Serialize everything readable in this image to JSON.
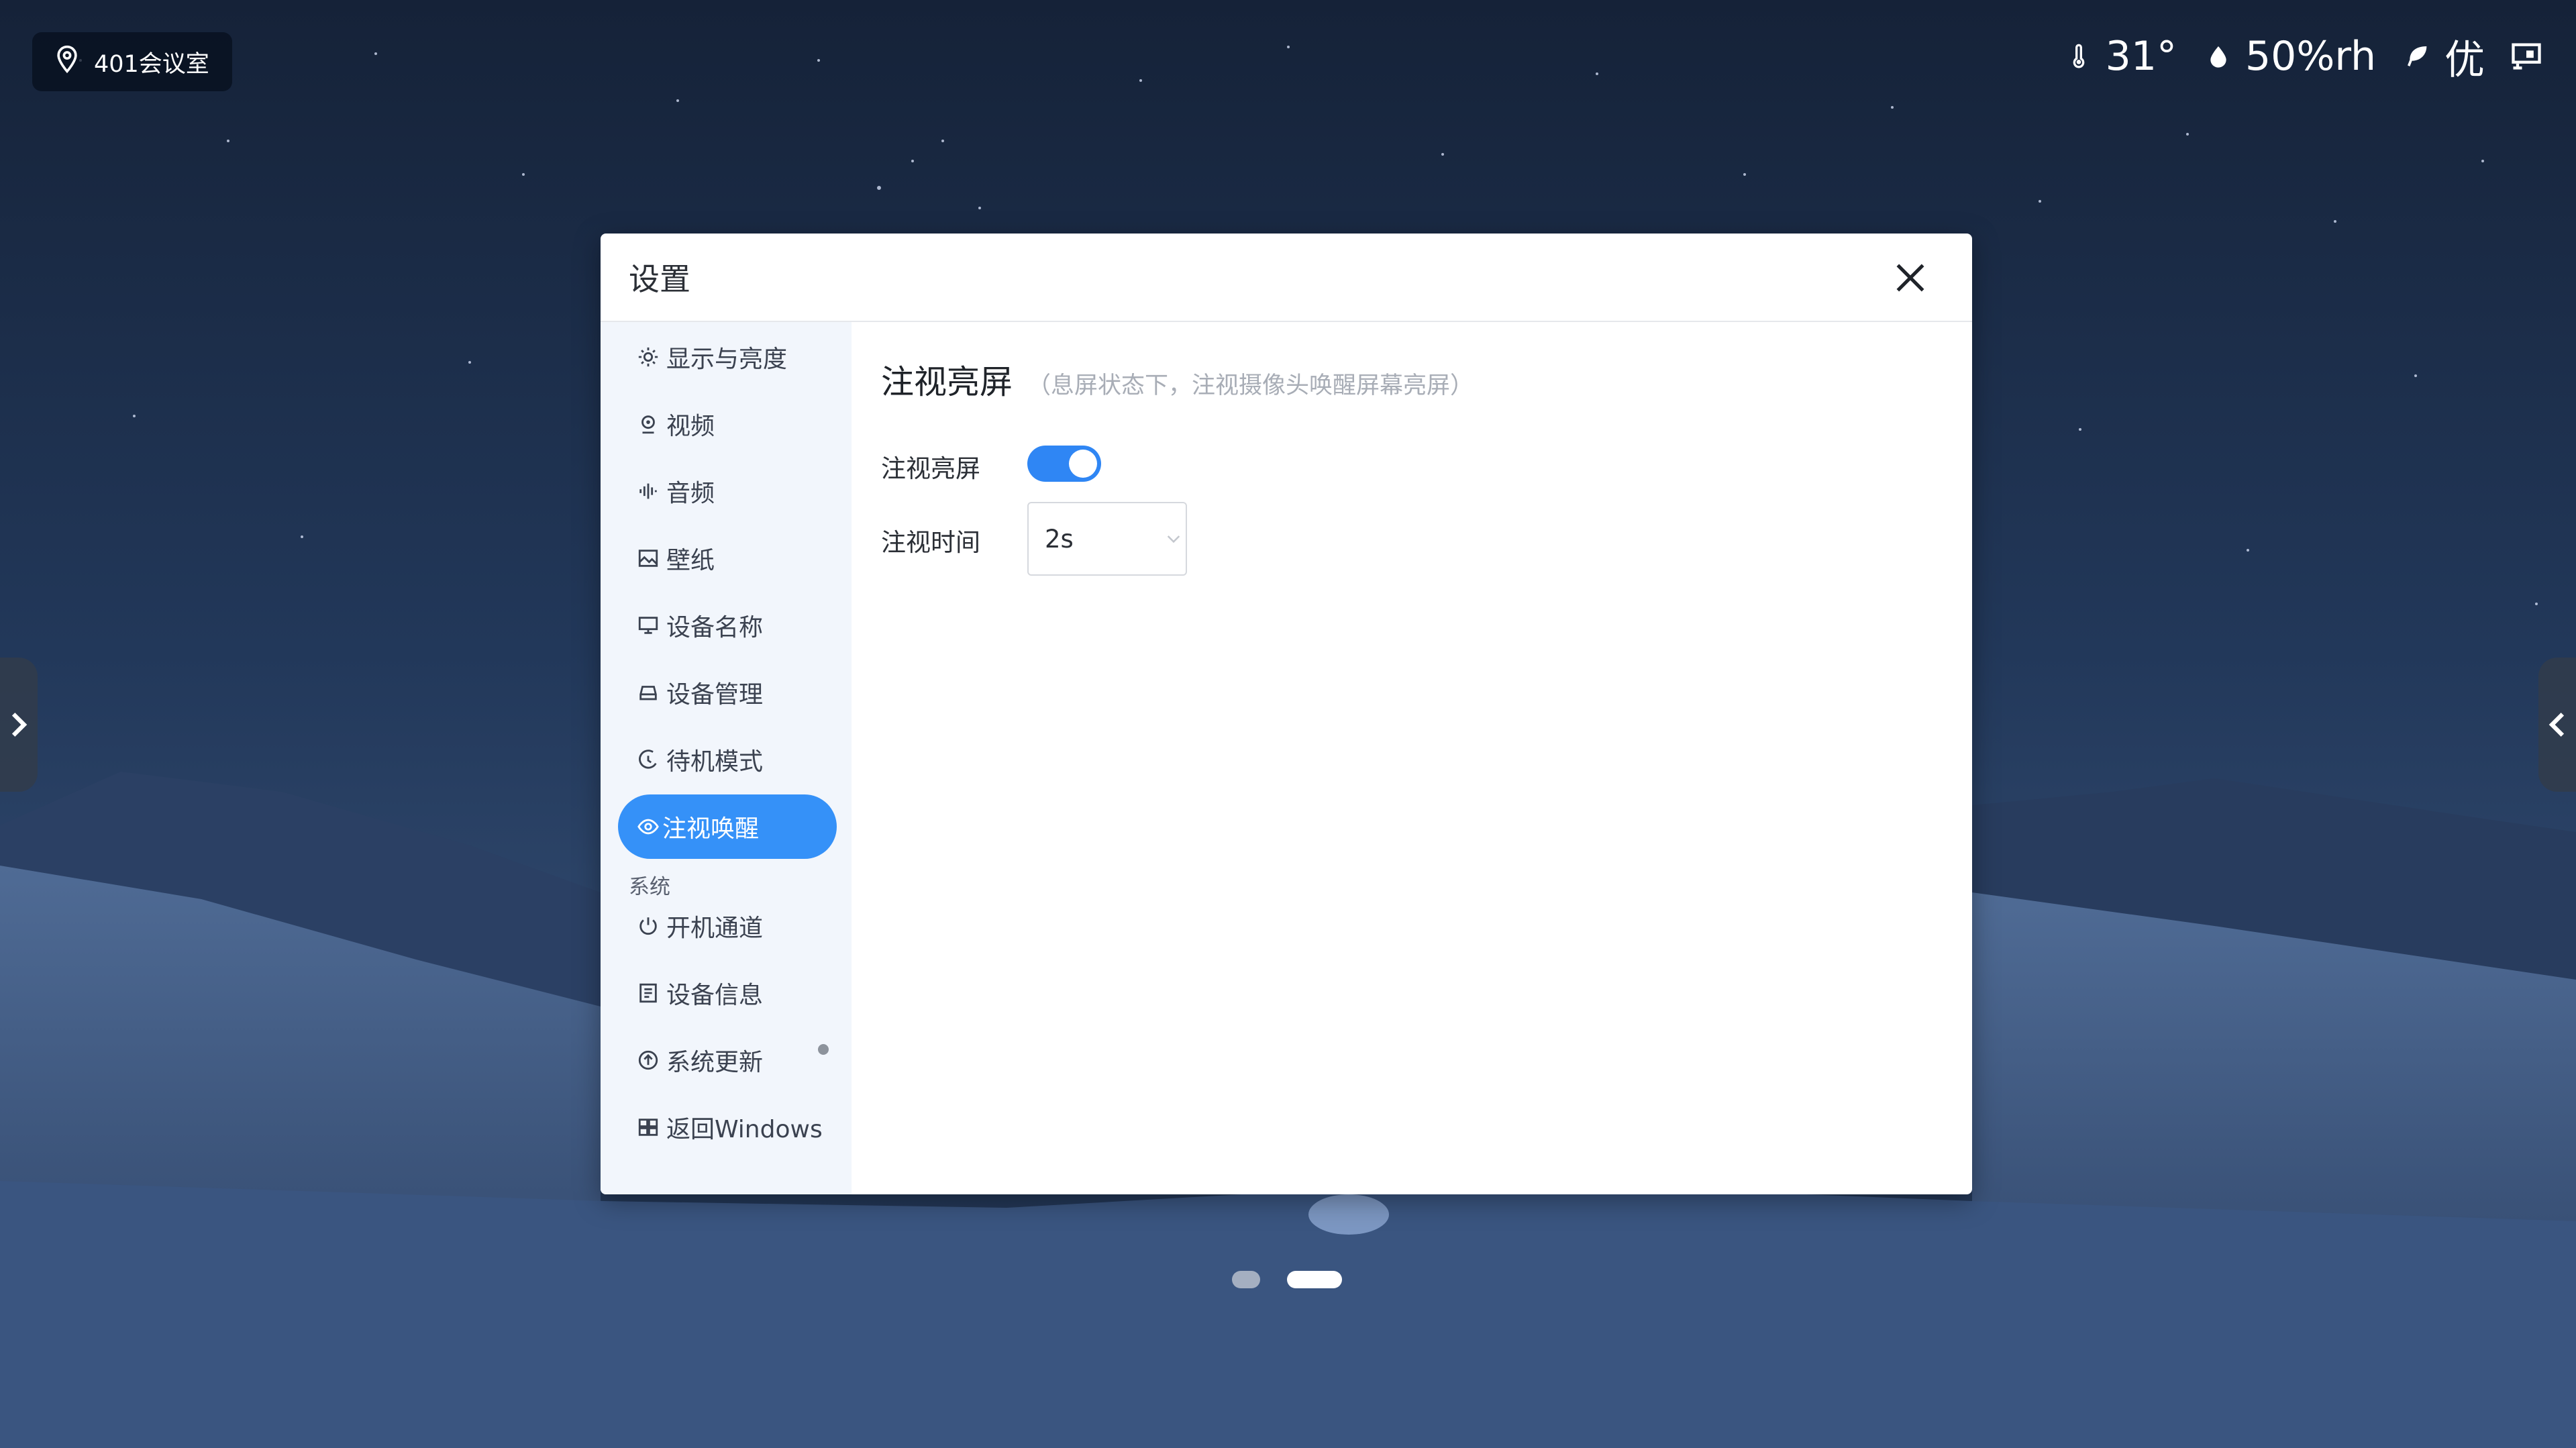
{
  "location": {
    "label": "401会议室",
    "icon": "location-pin-icon"
  },
  "status": {
    "temperature": "31°",
    "humidity": "50%rh",
    "air_quality": "优",
    "icons": [
      "thermometer-icon",
      "water-drop-icon",
      "leaf-icon",
      "screen-cast-icon"
    ]
  },
  "dialog": {
    "title": "设置",
    "sidebar": {
      "items": [
        {
          "label": "显示与亮度",
          "icon": "sun-icon"
        },
        {
          "label": "视频",
          "icon": "camera-icon"
        },
        {
          "label": "音频",
          "icon": "audio-wave-icon"
        },
        {
          "label": "壁纸",
          "icon": "image-icon"
        },
        {
          "label": "设备名称",
          "icon": "monitor-icon"
        },
        {
          "label": "设备管理",
          "icon": "device-manage-icon"
        },
        {
          "label": "待机模式",
          "icon": "standby-icon"
        },
        {
          "label": "注视唤醒",
          "icon": "eye-icon",
          "active": true
        }
      ],
      "group_label": "系统",
      "system_items": [
        {
          "label": "开机通道",
          "icon": "power-icon"
        },
        {
          "label": "设备信息",
          "icon": "info-doc-icon"
        },
        {
          "label": "系统更新",
          "icon": "update-arrow-icon",
          "has_badge": true
        },
        {
          "label": "返回Windows",
          "icon": "windows-icon"
        }
      ]
    },
    "content": {
      "title": "注视亮屏",
      "subtitle": "（息屏状态下，注视摄像头唤醒屏幕亮屏）",
      "toggle_label": "注视亮屏",
      "toggle_on": true,
      "duration_label": "注视时间",
      "duration_value": "2s"
    }
  },
  "pager": {
    "total": 2,
    "active": 2
  },
  "colors": {
    "accent": "#3591f8",
    "sidebar_bg": "#f2f6fc"
  }
}
